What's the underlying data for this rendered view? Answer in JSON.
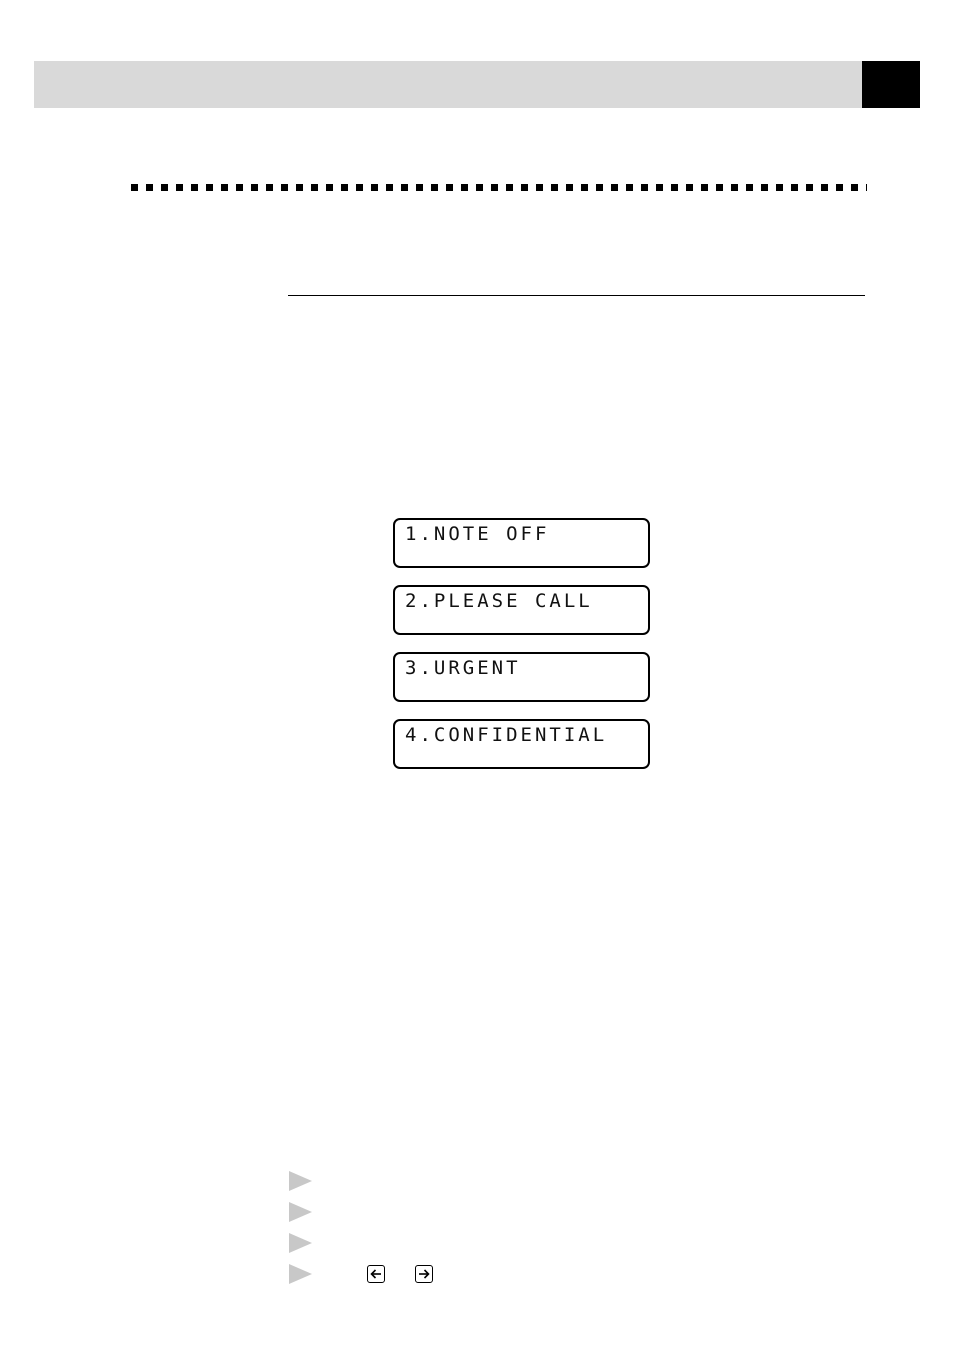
{
  "header": {
    "title": "",
    "page_tab": ""
  },
  "lcd_options": [
    {
      "text": "1.NOTE OFF"
    },
    {
      "text": "2.PLEASE CALL"
    },
    {
      "text": "3.URGENT"
    },
    {
      "text": "4.CONFIDENTIAL"
    }
  ],
  "steps": [
    {
      "marker": "arrow-bullet",
      "text": ""
    },
    {
      "marker": "arrow-bullet",
      "text": ""
    },
    {
      "marker": "arrow-bullet",
      "text": ""
    },
    {
      "marker": "arrow-bullet",
      "text": "",
      "keys": [
        "left-arrow-key",
        "right-arrow-key"
      ]
    }
  ],
  "colors": {
    "header_bar": "#d9d9d9",
    "header_tab": "#000000",
    "bullet": "#c8c8c8",
    "ink": "#000000"
  }
}
